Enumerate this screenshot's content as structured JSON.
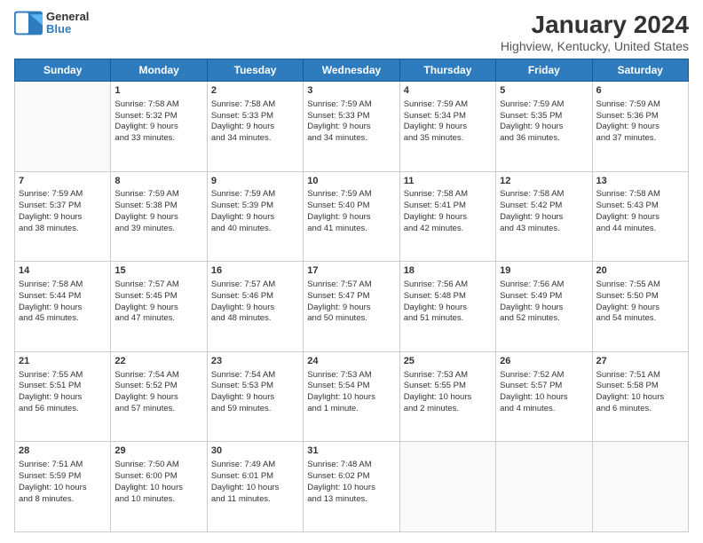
{
  "logo": {
    "line1": "General",
    "line2": "Blue"
  },
  "title": "January 2024",
  "subtitle": "Highview, Kentucky, United States",
  "days_of_week": [
    "Sunday",
    "Monday",
    "Tuesday",
    "Wednesday",
    "Thursday",
    "Friday",
    "Saturday"
  ],
  "weeks": [
    [
      {
        "day": "",
        "data": ""
      },
      {
        "day": "1",
        "data": "Sunrise: 7:58 AM\nSunset: 5:32 PM\nDaylight: 9 hours\nand 33 minutes."
      },
      {
        "day": "2",
        "data": "Sunrise: 7:58 AM\nSunset: 5:33 PM\nDaylight: 9 hours\nand 34 minutes."
      },
      {
        "day": "3",
        "data": "Sunrise: 7:59 AM\nSunset: 5:33 PM\nDaylight: 9 hours\nand 34 minutes."
      },
      {
        "day": "4",
        "data": "Sunrise: 7:59 AM\nSunset: 5:34 PM\nDaylight: 9 hours\nand 35 minutes."
      },
      {
        "day": "5",
        "data": "Sunrise: 7:59 AM\nSunset: 5:35 PM\nDaylight: 9 hours\nand 36 minutes."
      },
      {
        "day": "6",
        "data": "Sunrise: 7:59 AM\nSunset: 5:36 PM\nDaylight: 9 hours\nand 37 minutes."
      }
    ],
    [
      {
        "day": "7",
        "data": "Sunrise: 7:59 AM\nSunset: 5:37 PM\nDaylight: 9 hours\nand 38 minutes."
      },
      {
        "day": "8",
        "data": "Sunrise: 7:59 AM\nSunset: 5:38 PM\nDaylight: 9 hours\nand 39 minutes."
      },
      {
        "day": "9",
        "data": "Sunrise: 7:59 AM\nSunset: 5:39 PM\nDaylight: 9 hours\nand 40 minutes."
      },
      {
        "day": "10",
        "data": "Sunrise: 7:59 AM\nSunset: 5:40 PM\nDaylight: 9 hours\nand 41 minutes."
      },
      {
        "day": "11",
        "data": "Sunrise: 7:58 AM\nSunset: 5:41 PM\nDaylight: 9 hours\nand 42 minutes."
      },
      {
        "day": "12",
        "data": "Sunrise: 7:58 AM\nSunset: 5:42 PM\nDaylight: 9 hours\nand 43 minutes."
      },
      {
        "day": "13",
        "data": "Sunrise: 7:58 AM\nSunset: 5:43 PM\nDaylight: 9 hours\nand 44 minutes."
      }
    ],
    [
      {
        "day": "14",
        "data": "Sunrise: 7:58 AM\nSunset: 5:44 PM\nDaylight: 9 hours\nand 45 minutes."
      },
      {
        "day": "15",
        "data": "Sunrise: 7:57 AM\nSunset: 5:45 PM\nDaylight: 9 hours\nand 47 minutes."
      },
      {
        "day": "16",
        "data": "Sunrise: 7:57 AM\nSunset: 5:46 PM\nDaylight: 9 hours\nand 48 minutes."
      },
      {
        "day": "17",
        "data": "Sunrise: 7:57 AM\nSunset: 5:47 PM\nDaylight: 9 hours\nand 50 minutes."
      },
      {
        "day": "18",
        "data": "Sunrise: 7:56 AM\nSunset: 5:48 PM\nDaylight: 9 hours\nand 51 minutes."
      },
      {
        "day": "19",
        "data": "Sunrise: 7:56 AM\nSunset: 5:49 PM\nDaylight: 9 hours\nand 52 minutes."
      },
      {
        "day": "20",
        "data": "Sunrise: 7:55 AM\nSunset: 5:50 PM\nDaylight: 9 hours\nand 54 minutes."
      }
    ],
    [
      {
        "day": "21",
        "data": "Sunrise: 7:55 AM\nSunset: 5:51 PM\nDaylight: 9 hours\nand 56 minutes."
      },
      {
        "day": "22",
        "data": "Sunrise: 7:54 AM\nSunset: 5:52 PM\nDaylight: 9 hours\nand 57 minutes."
      },
      {
        "day": "23",
        "data": "Sunrise: 7:54 AM\nSunset: 5:53 PM\nDaylight: 9 hours\nand 59 minutes."
      },
      {
        "day": "24",
        "data": "Sunrise: 7:53 AM\nSunset: 5:54 PM\nDaylight: 10 hours\nand 1 minute."
      },
      {
        "day": "25",
        "data": "Sunrise: 7:53 AM\nSunset: 5:55 PM\nDaylight: 10 hours\nand 2 minutes."
      },
      {
        "day": "26",
        "data": "Sunrise: 7:52 AM\nSunset: 5:57 PM\nDaylight: 10 hours\nand 4 minutes."
      },
      {
        "day": "27",
        "data": "Sunrise: 7:51 AM\nSunset: 5:58 PM\nDaylight: 10 hours\nand 6 minutes."
      }
    ],
    [
      {
        "day": "28",
        "data": "Sunrise: 7:51 AM\nSunset: 5:59 PM\nDaylight: 10 hours\nand 8 minutes."
      },
      {
        "day": "29",
        "data": "Sunrise: 7:50 AM\nSunset: 6:00 PM\nDaylight: 10 hours\nand 10 minutes."
      },
      {
        "day": "30",
        "data": "Sunrise: 7:49 AM\nSunset: 6:01 PM\nDaylight: 10 hours\nand 11 minutes."
      },
      {
        "day": "31",
        "data": "Sunrise: 7:48 AM\nSunset: 6:02 PM\nDaylight: 10 hours\nand 13 minutes."
      },
      {
        "day": "",
        "data": ""
      },
      {
        "day": "",
        "data": ""
      },
      {
        "day": "",
        "data": ""
      }
    ]
  ]
}
